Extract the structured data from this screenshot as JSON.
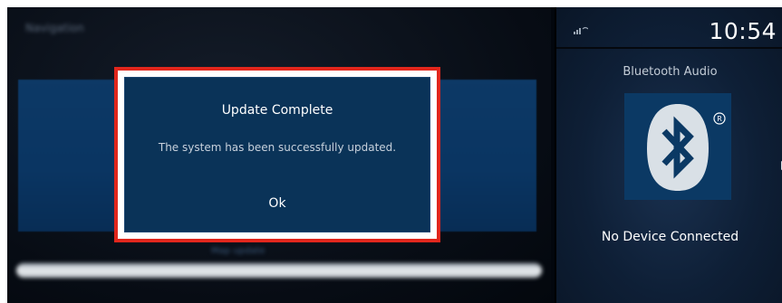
{
  "background_app": {
    "title": "Navigation",
    "caption": "Map update"
  },
  "dialog": {
    "title": "Update Complete",
    "message": "The system has been successfully updated.",
    "ok_label": "Ok",
    "highlight_color": "#e1261c"
  },
  "side_panel": {
    "time": "10:54",
    "source_label": "Bluetooth Audio",
    "status": "No Device Connected",
    "icons": [
      "signal-icon",
      "bluetooth-icon",
      "registered-mark-icon"
    ]
  },
  "colors": {
    "accent_blue": "#0b3964",
    "panel_blue": "#0d3966",
    "highlight_red": "#e1261c"
  }
}
